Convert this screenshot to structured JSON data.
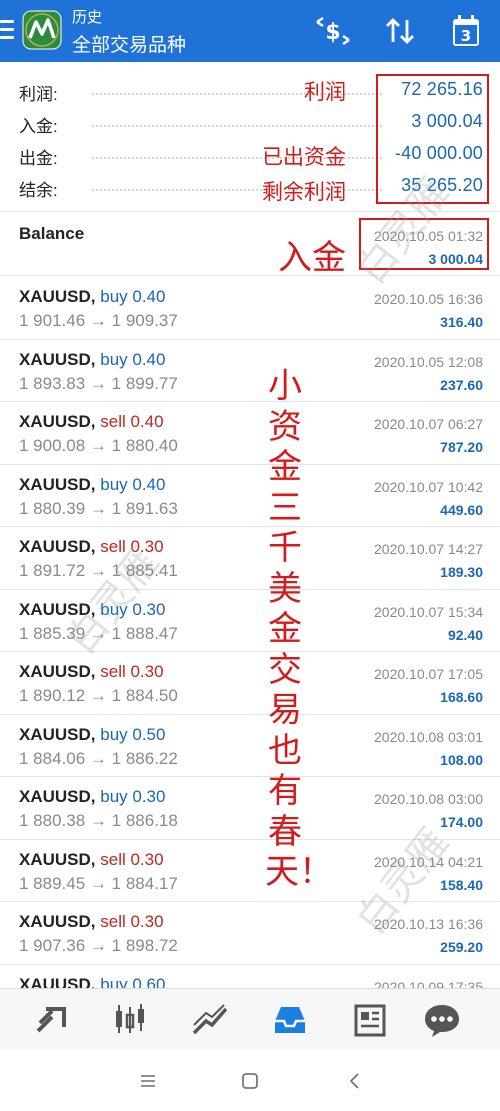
{
  "header": {
    "subtitle": "历史",
    "title": "全部交易品种",
    "icons": [
      "menu-icon",
      "metatrader-logo-icon",
      "currency-filter-icon",
      "sort-icon",
      "calendar-icon"
    ],
    "calendar_day": "3"
  },
  "summary": [
    {
      "label": "利润:",
      "value": "72 265.16"
    },
    {
      "label": "入金:",
      "value": "3 000.04"
    },
    {
      "label": "出金:",
      "value": "-40 000.00"
    },
    {
      "label": "结余:",
      "value": "35 265.20"
    }
  ],
  "balance": {
    "label": "Balance",
    "time": "2020.10.05 01:32",
    "amount": "3 000.04"
  },
  "trades": [
    {
      "symbol": "XAUUSD,",
      "side": "buy 0.40",
      "dir": "buy",
      "open": "1 901.46",
      "close": "1 909.37",
      "time": "2020.10.05 16:36",
      "profit": "316.40"
    },
    {
      "symbol": "XAUUSD,",
      "side": "buy 0.40",
      "dir": "buy",
      "open": "1 893.83",
      "close": "1 899.77",
      "time": "2020.10.05 12:08",
      "profit": "237.60"
    },
    {
      "symbol": "XAUUSD,",
      "side": "sell 0.40",
      "dir": "sell",
      "open": "1 900.08",
      "close": "1 880.40",
      "time": "2020.10.07 06:27",
      "profit": "787.20"
    },
    {
      "symbol": "XAUUSD,",
      "side": "buy 0.40",
      "dir": "buy",
      "open": "1 880.39",
      "close": "1 891.63",
      "time": "2020.10.07 10:42",
      "profit": "449.60"
    },
    {
      "symbol": "XAUUSD,",
      "side": "sell 0.30",
      "dir": "sell",
      "open": "1 891.72",
      "close": "1 885.41",
      "time": "2020.10.07 14:27",
      "profit": "189.30"
    },
    {
      "symbol": "XAUUSD,",
      "side": "buy 0.30",
      "dir": "buy",
      "open": "1 885.39",
      "close": "1 888.47",
      "time": "2020.10.07 15:34",
      "profit": "92.40"
    },
    {
      "symbol": "XAUUSD,",
      "side": "sell 0.30",
      "dir": "sell",
      "open": "1 890.12",
      "close": "1 884.50",
      "time": "2020.10.07 17:05",
      "profit": "168.60"
    },
    {
      "symbol": "XAUUSD,",
      "side": "buy 0.50",
      "dir": "buy",
      "open": "1 884.06",
      "close": "1 886.22",
      "time": "2020.10.08 03:01",
      "profit": "108.00"
    },
    {
      "symbol": "XAUUSD,",
      "side": "buy 0.30",
      "dir": "buy",
      "open": "1 880.38",
      "close": "1 886.18",
      "time": "2020.10.08 03:00",
      "profit": "174.00"
    },
    {
      "symbol": "XAUUSD,",
      "side": "sell 0.30",
      "dir": "sell",
      "open": "1 889.45",
      "close": "1 884.17",
      "time": "2020.10.14 04:21",
      "profit": "158.40"
    },
    {
      "symbol": "XAUUSD,",
      "side": "sell 0.30",
      "dir": "sell",
      "open": "1 907.36",
      "close": "1 898.72",
      "time": "2020.10.13 16:36",
      "profit": "259.20"
    },
    {
      "symbol": "XAUUSD,",
      "side": "buy 0.60",
      "dir": "buy",
      "open": "",
      "close": "",
      "time": "2020.10.09 17:35",
      "profit": ""
    }
  ],
  "arrow": "→",
  "annotations": {
    "profit": "利润",
    "withdrawn": "已出资金",
    "remaining": "剩余利润",
    "deposit": "入金",
    "vertical": "小资金三千美金交易也有春天！",
    "watermark": "白灵雁"
  },
  "tabbar": [
    "quotes-icon",
    "chart-icon",
    "trade-icon",
    "history-icon",
    "news-icon",
    "chat-icon"
  ],
  "navbar": [
    "recent-apps-icon",
    "home-icon",
    "back-icon"
  ],
  "colors": {
    "appbar": "#1f73d8",
    "value_blue": "#1a66b8",
    "sell_red": "#c0271f",
    "annotation_red": "#d41a1a"
  }
}
